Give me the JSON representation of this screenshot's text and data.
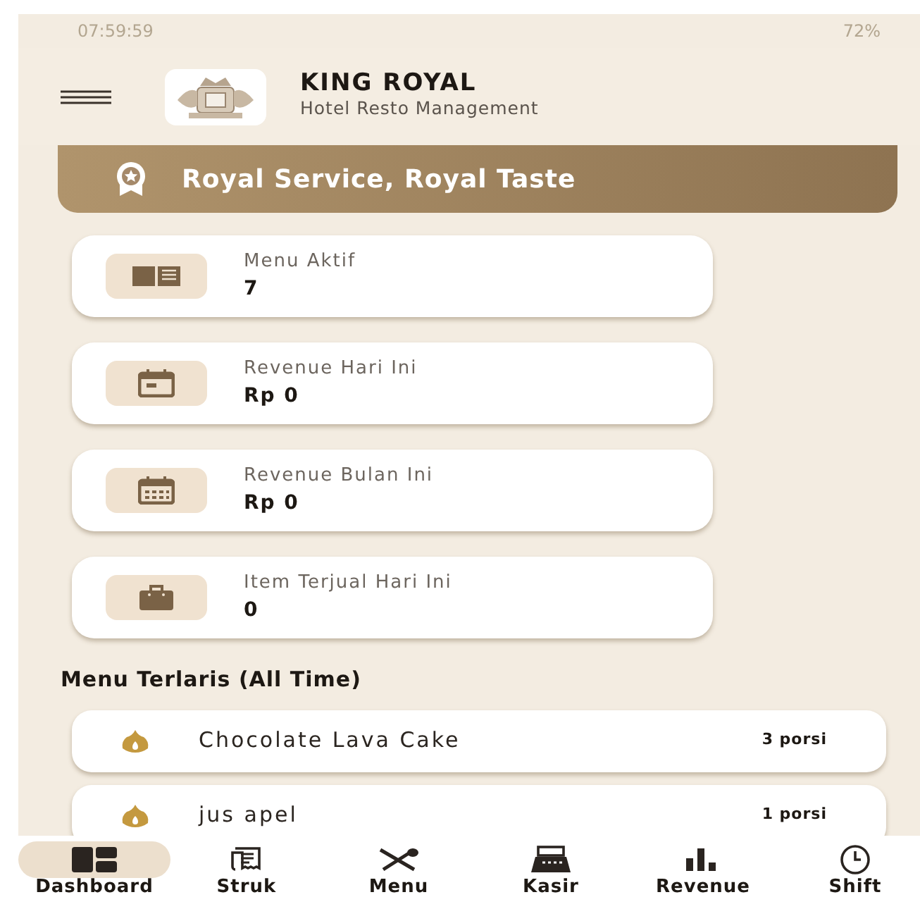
{
  "status_bar": {
    "time": "07:59:59",
    "battery": "72%"
  },
  "header": {
    "title": "KING ROYAL",
    "subtitle": "Hotel Resto Management"
  },
  "banner": {
    "text": "Royal Service, Royal Taste"
  },
  "stats": [
    {
      "kind": "book",
      "label": "Menu Aktif",
      "value": "7"
    },
    {
      "kind": "calendar-day",
      "label": "Revenue Hari Ini",
      "value": "Rp 0"
    },
    {
      "kind": "calendar-month",
      "label": "Revenue Bulan Ini",
      "value": "Rp 0"
    },
    {
      "kind": "bag",
      "label": "Item Terjual Hari Ini",
      "value": "0"
    }
  ],
  "best_sellers": {
    "title": "Menu Terlaris (All Time)",
    "items": [
      {
        "name": "Chocolate Lava Cake",
        "count": "3 porsi"
      },
      {
        "name": "jus apel",
        "count": "1 porsi"
      }
    ]
  },
  "bottom_nav": [
    {
      "kind": "dashboard",
      "label": "Dashboard",
      "selected": true
    },
    {
      "kind": "receipt",
      "label": "Struk",
      "selected": false
    },
    {
      "kind": "utensils",
      "label": "Menu",
      "selected": false
    },
    {
      "kind": "register",
      "label": "Kasir",
      "selected": false
    },
    {
      "kind": "chart",
      "label": "Revenue",
      "selected": false
    },
    {
      "kind": "clock",
      "label": "Shift",
      "selected": false
    }
  ]
}
